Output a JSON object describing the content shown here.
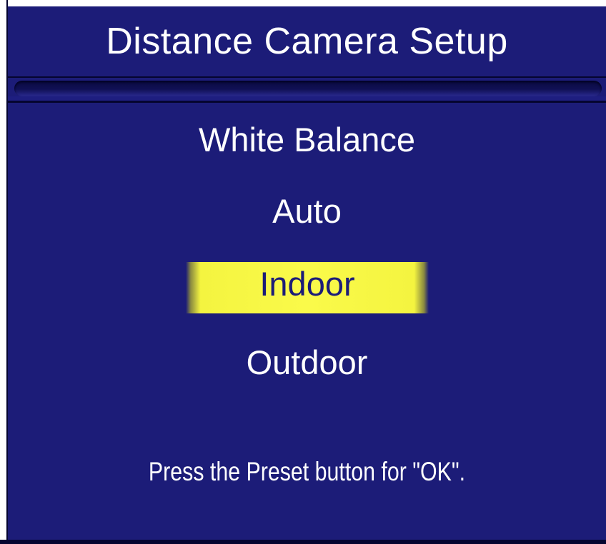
{
  "window": {
    "title": "Distance Camera Setup"
  },
  "menu": {
    "heading": "White Balance",
    "options": [
      {
        "label": "Auto",
        "selected": false
      },
      {
        "label": "Indoor",
        "selected": true
      },
      {
        "label": "Outdoor",
        "selected": false
      }
    ]
  },
  "footer": {
    "hint": "Press the Preset button  for \"OK\"."
  },
  "colors": {
    "background": "#1c1c78",
    "text": "#ffffff",
    "highlight": "#f8f845",
    "highlight_text": "#1c1c78"
  }
}
